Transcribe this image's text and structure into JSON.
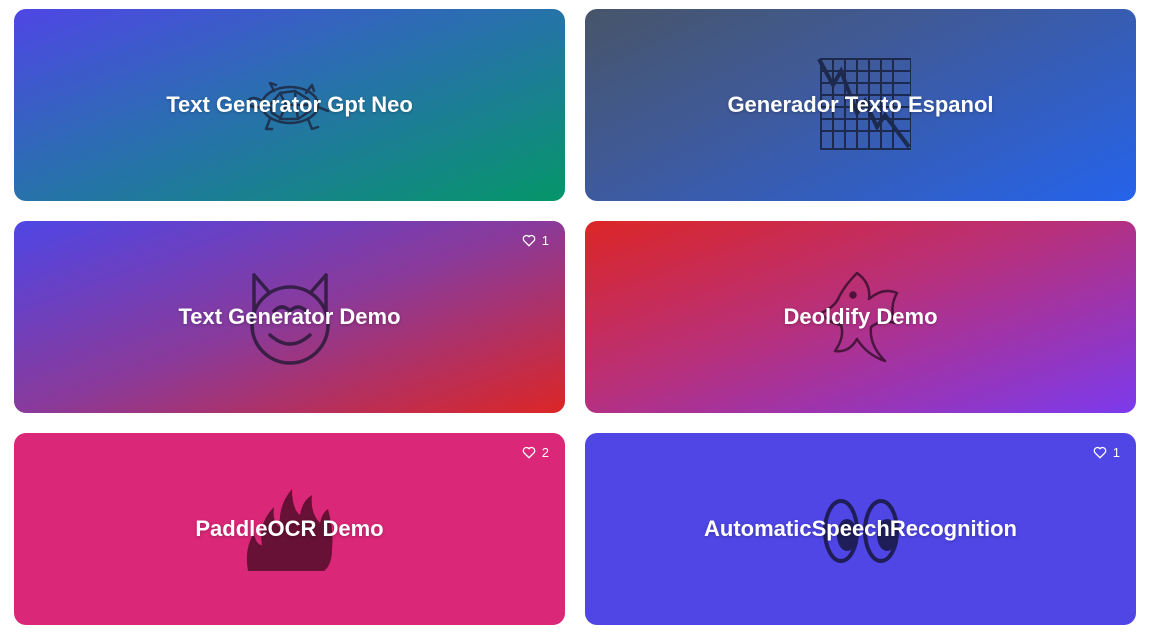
{
  "spaces": [
    {
      "title": "Text Generator Gpt Neo",
      "icon": "turtle-icon",
      "likes": ""
    },
    {
      "title": "Generador Texto Espanol",
      "icon": "chart-decreasing-icon",
      "likes": ""
    },
    {
      "title": "Text Generator Demo",
      "icon": "smiling-cat-icon",
      "likes": "1"
    },
    {
      "title": "Deoldify Demo",
      "icon": "tropical-fish-icon",
      "likes": ""
    },
    {
      "title": "PaddleOCR Demo",
      "icon": "fire-icon",
      "likes": "2"
    },
    {
      "title": "AutomaticSpeechRecognition",
      "icon": "eyes-icon",
      "likes": "1"
    }
  ]
}
